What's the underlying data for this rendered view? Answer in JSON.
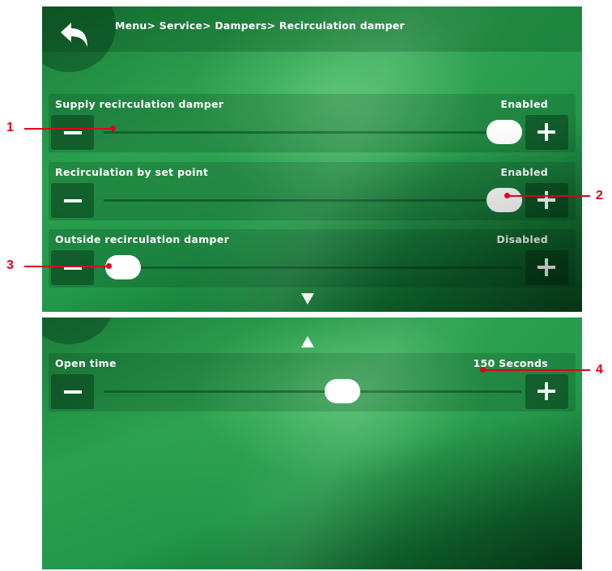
{
  "header": {
    "breadcrumb": "Menu> Service> Dampers> Recirculation damper",
    "back_icon": "back-arrow-icon"
  },
  "settings": [
    {
      "label": "Supply recirculation damper",
      "status": "Enabled",
      "slider_value": 1.0
    },
    {
      "label": "Recirculation by set point",
      "status": "Enabled",
      "slider_value": 1.0
    },
    {
      "label": "Outside recirculation damper",
      "status": "Disabled",
      "slider_value": 0.0
    }
  ],
  "page2": {
    "settings": [
      {
        "label": "Open time",
        "status": "150 Seconds",
        "slider_value": 0.55
      }
    ]
  },
  "navigation": {
    "scroll_down_icon": "triangle-down-icon",
    "scroll_up_icon": "triangle-up-icon"
  },
  "callouts": [
    "1",
    "2",
    "3",
    "4"
  ],
  "colors": {
    "background_green": "#2aa04f",
    "text": "#ffffff",
    "callout_red": "#e2001a"
  }
}
